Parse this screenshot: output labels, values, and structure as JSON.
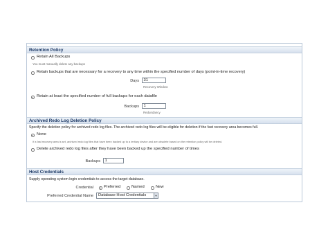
{
  "retention": {
    "title": "Retention Policy",
    "opt_all": "Retain All Backups",
    "opt_all_note": "You must manually delete any backups",
    "opt_recovery": "Retain backups that are necessary for a recovery to any time within the specified number of days (point-in-time recovery)",
    "days_label": "Days",
    "days_value": "31",
    "days_hint": "Recovery Window",
    "opt_full": "Retain at least the specified number of full backups for each datafile",
    "backups_label": "Backups",
    "backups_value": "1",
    "backups_hint": "Redundancy"
  },
  "archived": {
    "title": "Archived Redo Log Deletion Policy",
    "desc": "Specify the deletion policy for archived redo log files. The archived redo log files will be eligible for deletion if the fast recovery area becomes full.",
    "opt_none": "None",
    "opt_none_note": "If a fast recovery area is set, archived redo log files that have been backed up to a tertiary device and are obsolete based on the retention policy will be deleted.",
    "opt_delete": "Delete archived redo log files after they have been backed up the specified number of times",
    "backups_label": "Backups",
    "backups_value": "1"
  },
  "credentials": {
    "title": "Host Credentials",
    "desc": "Supply operating system login credentials to access the target database.",
    "credential_label": "Credential",
    "opt_preferred": "Preferred",
    "opt_named": "Named",
    "opt_new": "New",
    "pref_name_label": "Preferred Credential Name",
    "pref_name_value": "Database Host Credentials"
  }
}
